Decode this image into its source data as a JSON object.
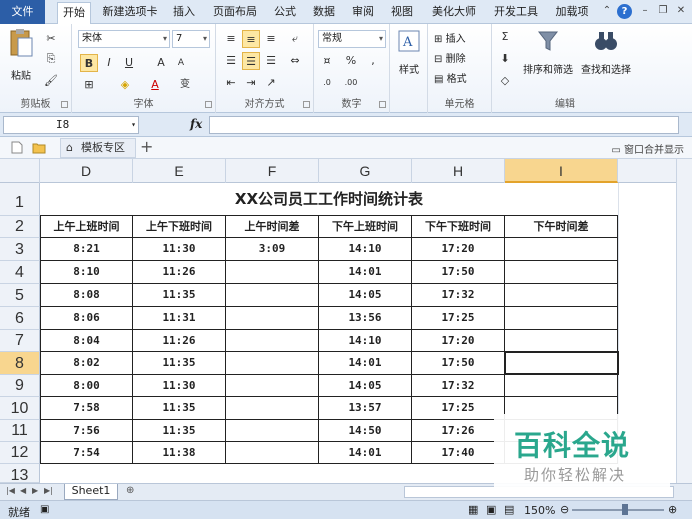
{
  "ribbon_tabs": [
    "文件",
    "开始",
    "新建选项卡",
    "插入",
    "页面布局",
    "公式",
    "数据",
    "审阅",
    "视图",
    "美化大师",
    "开发工具",
    "加载项"
  ],
  "ribbon": {
    "clipboard": {
      "label": "剪贴板",
      "paste": "粘贴"
    },
    "font": {
      "label": "字体",
      "name": "宋体",
      "size": "7",
      "phonetic": "变"
    },
    "alignment": {
      "label": "对齐方式"
    },
    "number": {
      "label": "数字",
      "format": "常规"
    },
    "styles": {
      "label": "样式",
      "button": "样式"
    },
    "cells": {
      "label": "单元格",
      "insert": "插入",
      "delete": "删除",
      "format": "格式"
    },
    "editing": {
      "label": "编辑",
      "sort": "排序和筛选",
      "find": "查找和选择"
    }
  },
  "formula_bar": {
    "name_box": "I8",
    "fx": "fx",
    "value": ""
  },
  "doc_tabs": {
    "template": "模板专区",
    "merge_windows": "窗口合并显示"
  },
  "columns": [
    "D",
    "E",
    "F",
    "G",
    "H",
    "I"
  ],
  "rows": [
    "1",
    "2",
    "3",
    "4",
    "5",
    "6",
    "7",
    "8",
    "9",
    "10",
    "11",
    "12",
    "13"
  ],
  "selected_cell": {
    "column": "I",
    "row": "8"
  },
  "sheet": {
    "title": "XX公司员工工作时间统计表",
    "headers": [
      "上午上班时间",
      "上午下班时间",
      "上午时间差",
      "下午上班时间",
      "下午下班时间",
      "下午时间差"
    ],
    "data": [
      [
        "8:21",
        "11:30",
        "3:09",
        "14:10",
        "17:20",
        ""
      ],
      [
        "8:10",
        "11:26",
        "",
        "14:01",
        "17:50",
        ""
      ],
      [
        "8:08",
        "11:35",
        "",
        "14:05",
        "17:32",
        ""
      ],
      [
        "8:06",
        "11:31",
        "",
        "13:56",
        "17:25",
        ""
      ],
      [
        "8:04",
        "11:26",
        "",
        "14:10",
        "17:20",
        ""
      ],
      [
        "8:02",
        "11:35",
        "",
        "14:01",
        "17:50",
        ""
      ],
      [
        "8:00",
        "11:30",
        "",
        "14:05",
        "17:32",
        ""
      ],
      [
        "7:58",
        "11:35",
        "",
        "13:57",
        "17:25",
        ""
      ],
      [
        "7:56",
        "11:35",
        "",
        "14:50",
        "17:26",
        ""
      ],
      [
        "7:54",
        "11:38",
        "",
        "14:01",
        "17:40",
        ""
      ]
    ]
  },
  "sheet_tabs": [
    "Sheet1"
  ],
  "status": {
    "ready": "就绪",
    "zoom": "150%"
  },
  "watermark": {
    "big": "百科全说",
    "small": "助你轻松解决"
  }
}
